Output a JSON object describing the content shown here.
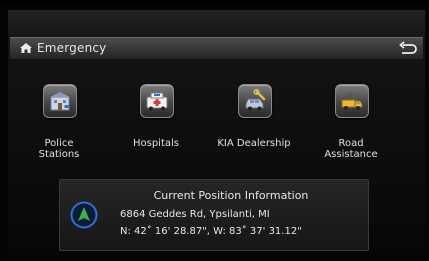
{
  "screen": {
    "title": "Emergency",
    "icons": {
      "home": "home-icon",
      "back": "return-arrow-icon"
    }
  },
  "menu": {
    "items": [
      {
        "label": "Police\nStations",
        "icon": "police-station-icon"
      },
      {
        "label": "Hospitals",
        "icon": "ambulance-icon"
      },
      {
        "label": "KIA Dealership",
        "icon": "car-repair-icon"
      },
      {
        "label": "Road\nAssistance",
        "icon": "tow-truck-icon"
      }
    ]
  },
  "position_panel": {
    "heading": "Current Position Information",
    "address": "6864 Geddes Rd, Ypsilanti, MI",
    "coordinates": "N: 42˚ 16' 28.87\", W: 83˚ 37' 31.12\"",
    "icon": "navigation-arrow-icon"
  },
  "colors": {
    "accent_green": "#39b54a",
    "accent_blue": "#2f6fd8",
    "title_bar": "#3c3c3c",
    "background": "#0d0d0d"
  }
}
